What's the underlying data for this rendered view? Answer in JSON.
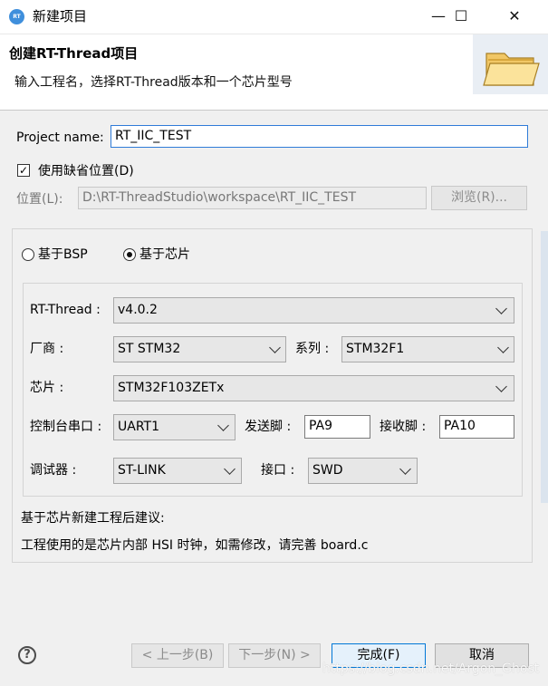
{
  "window": {
    "icon_text": "RT",
    "title": "新建项目",
    "controls": {
      "minimize": "—",
      "maximize": "☐",
      "close": "✕"
    }
  },
  "header": {
    "title": "创建RT-Thread项目",
    "description": "输入工程名，选择RT-Thread版本和一个芯片型号"
  },
  "project": {
    "name_label": "Project name:",
    "name_value": "RT_IIC_TEST",
    "use_default_label": "使用缺省位置(D)",
    "use_default_checked": "✓",
    "location_label": "位置(L):",
    "location_value": "D:\\RT-ThreadStudio\\workspace\\RT_IIC_TEST",
    "browse_button": "浏览(R)..."
  },
  "mode": {
    "bsp_label": "基于BSP",
    "chip_label": "基于芯片"
  },
  "chip_config": {
    "rt_thread_label": "RT-Thread :",
    "rt_thread_value": "v4.0.2",
    "vendor_label": "厂商 :",
    "vendor_value": "ST STM32",
    "series_label": "系列 :",
    "series_value": "STM32F1",
    "chip_label": "芯片 :",
    "chip_value": "STM32F103ZETx",
    "console_uart_label": "控制台串口 :",
    "console_uart_value": "UART1",
    "tx_pin_label": "发送脚 :",
    "tx_pin_value": "PA9",
    "rx_pin_label": "接收脚 :",
    "rx_pin_value": "PA10",
    "debugger_label": "调试器 :",
    "debugger_value": "ST-LINK",
    "interface_label": "接口 :",
    "interface_value": "SWD"
  },
  "advice": {
    "title": "基于芯片新建工程后建议:",
    "text": "工程使用的是芯片内部 HSI 时钟，如需修改，请完善 board.c"
  },
  "footer": {
    "help_icon_text": "?",
    "back_button": "< 上一步(B)",
    "next_button": "下一步(N) >",
    "finish_button": "完成(F)",
    "cancel_button": "取消"
  },
  "watermark": "https://blog.csdn.net/Argon_Ghost"
}
